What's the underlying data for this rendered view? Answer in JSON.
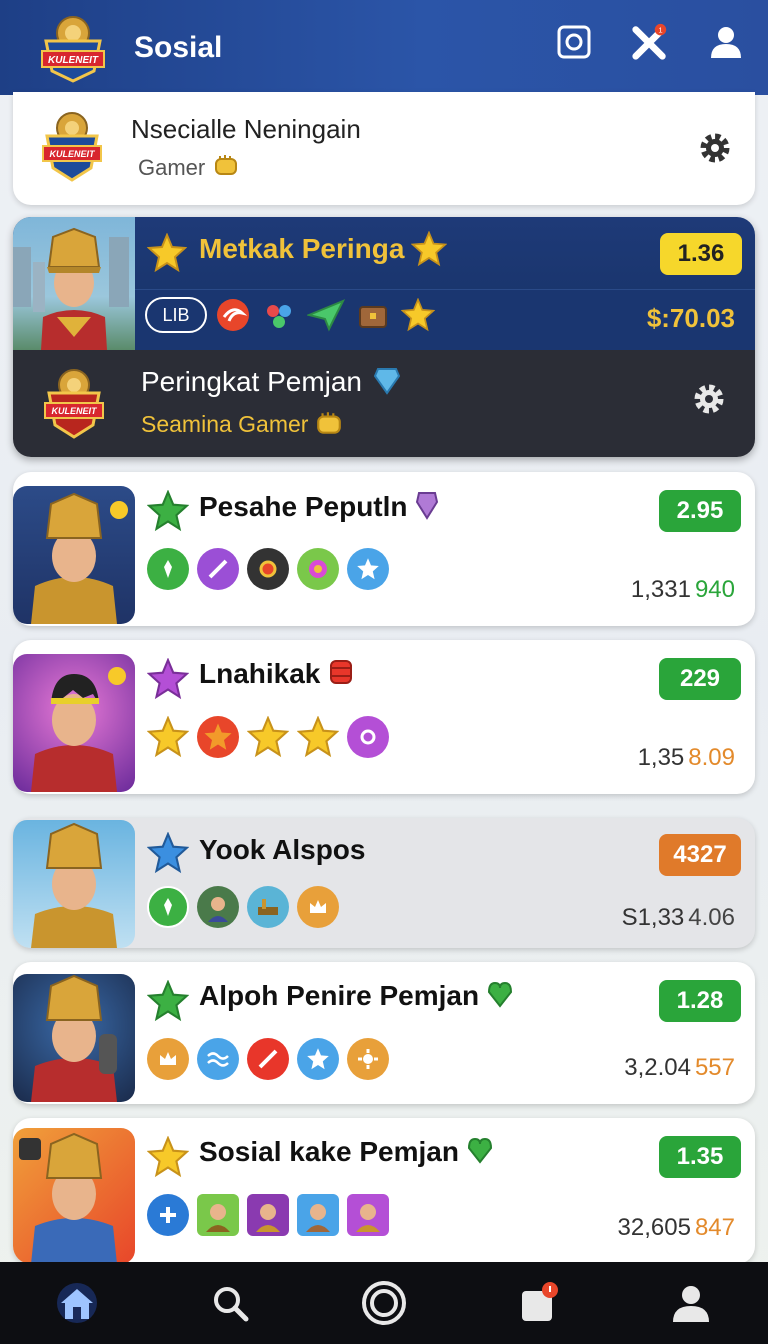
{
  "header": {
    "title": "Sosial",
    "logo_text": "KULENEIT",
    "icons": [
      "camera-icon",
      "crossed-swords-icon",
      "profile-icon"
    ]
  },
  "profile": {
    "name": "Nsecialle Neningain",
    "subtitle": "Gamer",
    "logo_text": "KULENEIT"
  },
  "featured": {
    "title": "Metkak Peringa",
    "score": "1.36",
    "tag": "LIB",
    "money": "$:70.03",
    "sub_title": "Peringkat Pemjan",
    "sub_subtitle": "Seamina Gamer",
    "logo_text": "KULENEIT"
  },
  "players": [
    {
      "name": "Pesahe Peputln",
      "score": "2.95",
      "score_color": "#2aa53a",
      "stat_main": "1,331",
      "stat_hl": "940",
      "hl_color": "#2aa53a",
      "star_color": "#3cb043",
      "grey": false
    },
    {
      "name": "Lnahikak",
      "score": "229",
      "score_color": "#2aa53a",
      "stat_main": "1,35",
      "stat_hl": "8.09",
      "hl_color": "#e38a2b",
      "star_color": "#b44fd6",
      "grey": false
    },
    {
      "name": "Yook Alspos",
      "score": "4327",
      "score_color": "#e07a2a",
      "stat_main": "S1,33",
      "stat_hl": "4.06",
      "hl_color": "#444",
      "star_color": "#3b8fe0",
      "grey": true
    },
    {
      "name": "Alpoh Penire Pemjan",
      "score": "1.28",
      "score_color": "#2aa53a",
      "stat_main": "3,2.04",
      "stat_hl": "557",
      "hl_color": "#e38a2b",
      "star_color": "#3cb043",
      "grey": false
    },
    {
      "name": "Sosial kake Pemjan",
      "score": "1.35",
      "score_color": "#2aa53a",
      "stat_main": "32,605",
      "stat_hl": "847",
      "hl_color": "#e38a2b",
      "star_color": "#f2c21b",
      "grey": false
    }
  ],
  "nav": [
    "home-icon",
    "search-icon",
    "record-icon",
    "notifications-icon",
    "profile-icon"
  ]
}
